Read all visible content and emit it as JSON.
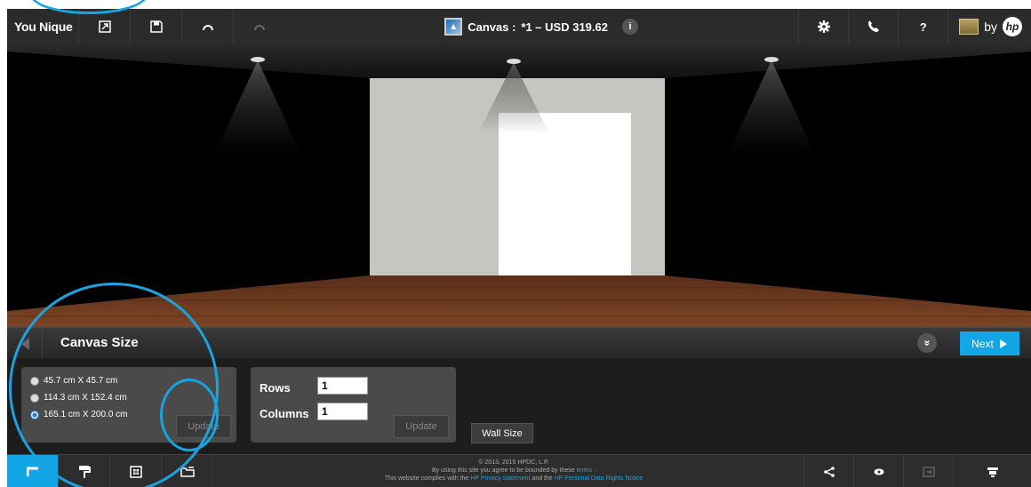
{
  "app": {
    "brand": "You Nique",
    "by_label": "by",
    "hp_logo": "hp"
  },
  "toolbar": {
    "canvas_label": "Canvas :",
    "canvas_detail": "*1 – USD 319.62",
    "info_label": "i",
    "icons": [
      "expand-icon",
      "save-icon",
      "undo-icon",
      "redo-icon",
      "settings-icon",
      "support-icon",
      "help-icon"
    ]
  },
  "panel": {
    "title": "Canvas Size",
    "next_label": "Next",
    "collapse_label": "»"
  },
  "sizes": {
    "options": [
      {
        "label": "45.7 cm X 45.7 cm",
        "checked": false
      },
      {
        "label": "114.3 cm X 152.4 cm",
        "checked": false
      },
      {
        "label": "165.1 cm X 200.0 cm",
        "checked": true
      }
    ],
    "update_label": "Update"
  },
  "grid": {
    "rows_label": "Rows",
    "rows_value": "1",
    "columns_label": "Columns",
    "columns_value": "1",
    "update_label": "Update"
  },
  "wall_size_label": "Wall Size",
  "footer": {
    "line1": "© 2013, 2015 HPDC, L.P.",
    "line2_pre": "By using this site you agree to be bounded by these",
    "line2_link": "terms",
    "line2_post": ".",
    "line3_pre": "This website complies with the",
    "line3_link1": "HP Privacy statement",
    "line3_mid": "and the",
    "line3_link2": "HP Personal Data Rights Notice"
  },
  "colors": {
    "accent": "#13a6e6",
    "annotation": "#19a3e0",
    "toolbar_bg": "#2b2b2b",
    "wall": "#c8c8c4",
    "floor": "#6a3820"
  }
}
